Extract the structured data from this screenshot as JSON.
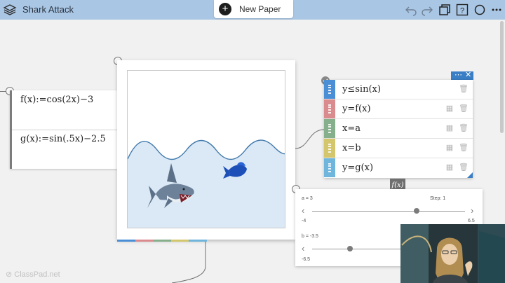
{
  "header": {
    "title": "Shark Attack",
    "new_paper_label": "New Paper",
    "icons": [
      "undo-icon",
      "redo-icon",
      "copy-icon",
      "help-icon",
      "record-icon",
      "more-icon"
    ]
  },
  "math_card": {
    "f_def": "f(x):=cos(2x)−3",
    "g_def": "g(x):=sin(.5x)−2.5"
  },
  "equations": {
    "rows": [
      {
        "text": "y≤sin(x)",
        "color": "#4a8fd6"
      },
      {
        "text": "y=f(x)",
        "color": "#d98b8e"
      },
      {
        "text": "x=a",
        "color": "#86b08c"
      },
      {
        "text": "x=b",
        "color": "#d4c66c"
      },
      {
        "text": "y=g(x)",
        "color": "#6fb5dc"
      }
    ],
    "menu_icon": "more-icon",
    "close_icon": "close-icon",
    "fx_label": "f(x)"
  },
  "sliders": {
    "a": {
      "label": "a = 3",
      "step": "Step: 1",
      "min": "-4",
      "max": "6.5",
      "value": 3
    },
    "b": {
      "label": "b = -3.5",
      "min": "-6.5",
      "value": -3.5
    }
  },
  "canvas": {
    "water_color": "#dbe9f6",
    "wave_color": "#3f77aa",
    "tab_colors": [
      "#4a8fd6",
      "#d98b8e",
      "#86b08c",
      "#d4c66c",
      "#6fb5dc"
    ]
  },
  "footer": {
    "brand": "ClassPad.net"
  }
}
